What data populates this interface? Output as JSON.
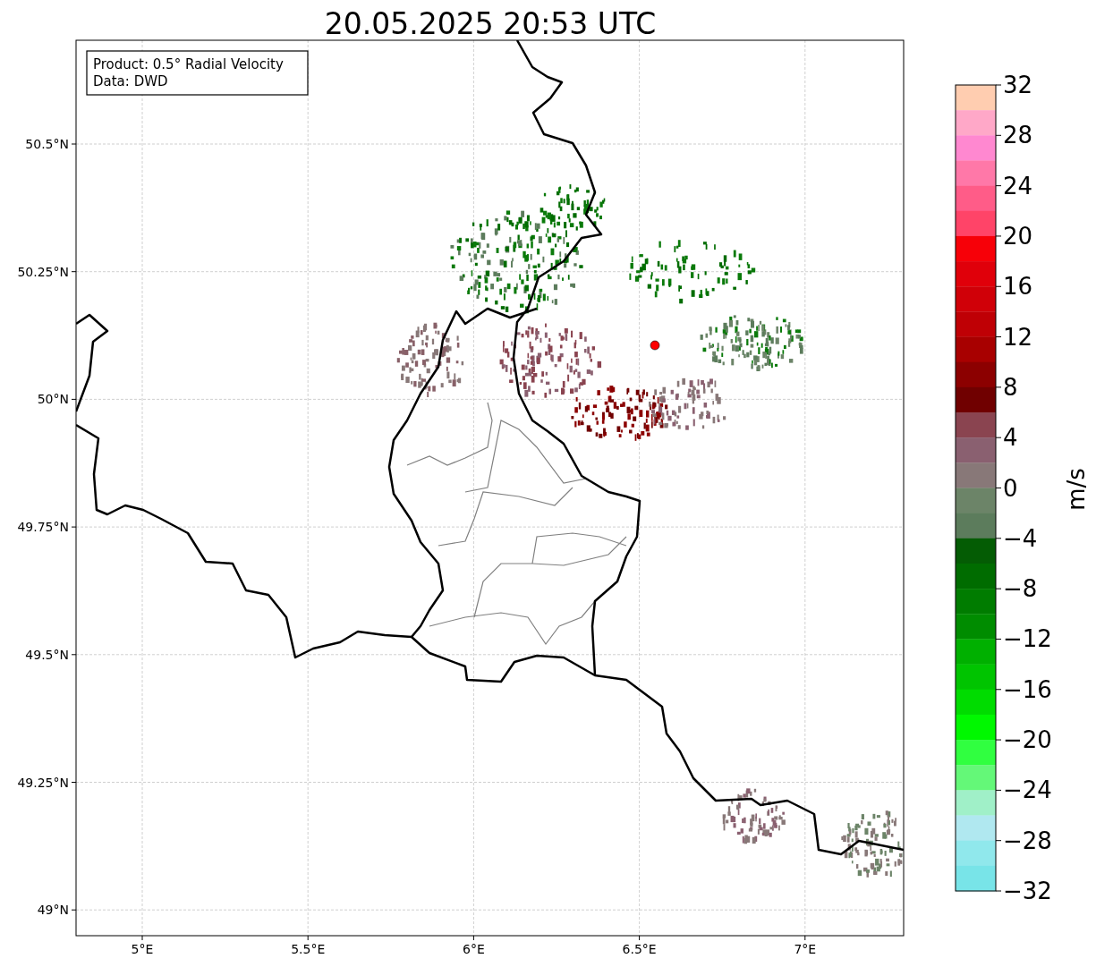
{
  "title": "20.05.2025 20:53 UTC",
  "info_box": {
    "lines": [
      "Product: 0.5° Radial Velocity",
      "Data: DWD"
    ]
  },
  "map": {
    "yticks": [
      "50.5°N",
      "50.25°N",
      "50°N",
      "49.75°N",
      "49.5°N",
      "49.25°N",
      "49°N"
    ],
    "xticks": [
      "5°E",
      "5.5°E",
      "6°E",
      "6.5°E",
      "7°E"
    ]
  },
  "colorbar": {
    "label": "m/s",
    "ticks": [
      "32",
      "28",
      "24",
      "20",
      "16",
      "12",
      "8",
      "4",
      "0",
      "−4",
      "−8",
      "−12",
      "−16",
      "−20",
      "−24",
      "−28",
      "−32"
    ],
    "bands": [
      {
        "color": "#ffcdb0"
      },
      {
        "color": "#ffa8c8"
      },
      {
        "color": "#ff88d0"
      },
      {
        "color": "#ff78a8"
      },
      {
        "color": "#ff5c88"
      },
      {
        "color": "#ff4468"
      },
      {
        "color": "#f70008"
      },
      {
        "color": "#e0000a"
      },
      {
        "color": "#d00008"
      },
      {
        "color": "#bf0005"
      },
      {
        "color": "#a80000"
      },
      {
        "color": "#8c0000"
      },
      {
        "color": "#700000"
      },
      {
        "color": "#8a4450"
      },
      {
        "color": "#8a6070"
      },
      {
        "color": "#887878"
      },
      {
        "color": "#6c8468"
      },
      {
        "color": "#5c7c5c"
      },
      {
        "color": "#045c04"
      },
      {
        "color": "#006c00"
      },
      {
        "color": "#007c00"
      },
      {
        "color": "#008c00"
      },
      {
        "color": "#00b000"
      },
      {
        "color": "#00c400"
      },
      {
        "color": "#00dc00"
      },
      {
        "color": "#00f800"
      },
      {
        "color": "#30ff40"
      },
      {
        "color": "#64f878"
      },
      {
        "color": "#a0f0c8"
      },
      {
        "color": "#b0e8f0"
      },
      {
        "color": "#90e8ec"
      },
      {
        "color": "#78e4e8"
      }
    ]
  }
}
